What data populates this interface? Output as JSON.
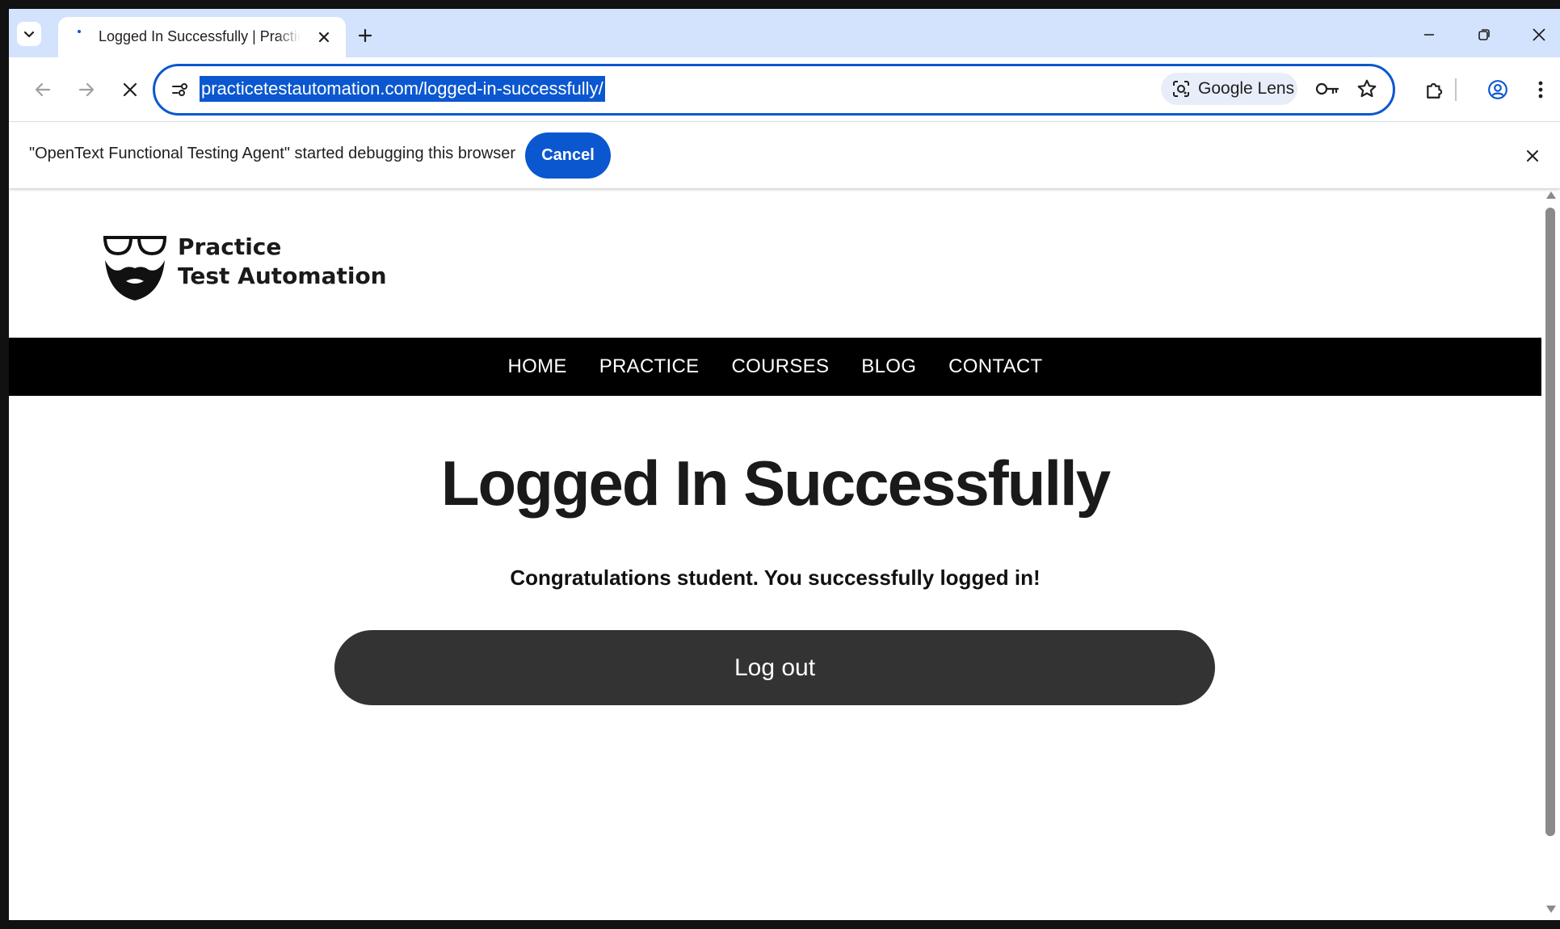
{
  "browser": {
    "tab": {
      "title": "Logged In Successfully | Practice Test Automation"
    },
    "address_bar": {
      "url": "practicetestautomation.com/logged-in-successfully/"
    },
    "lens_chip": {
      "label": "Google Lens"
    }
  },
  "infobar": {
    "message": "\"OpenText Functional Testing Agent\" started debugging this browser",
    "cancel_label": "Cancel"
  },
  "page": {
    "logo": {
      "line1": "Practice",
      "line2": "Test Automation"
    },
    "nav": {
      "items": [
        {
          "label": "HOME"
        },
        {
          "label": "PRACTICE"
        },
        {
          "label": "COURSES"
        },
        {
          "label": "BLOG"
        },
        {
          "label": "CONTACT"
        }
      ]
    },
    "heading": "Logged In Successfully",
    "message": "Congratulations student. You successfully logged in!",
    "logout_label": "Log out"
  },
  "colors": {
    "tabstrip": "#d3e3fd",
    "accent": "#0b57d0",
    "nav_bg": "#000000",
    "button_bg": "#333333"
  },
  "icons": [
    "tab-search-icon",
    "close-icon",
    "plus-icon",
    "minimize-icon",
    "restore-icon",
    "back-arrow-icon",
    "forward-arrow-icon",
    "stop-loading-icon",
    "site-info-icon",
    "google-lens-icon",
    "key-icon",
    "star-icon",
    "extensions-icon",
    "profile-icon",
    "more-vert-icon"
  ]
}
